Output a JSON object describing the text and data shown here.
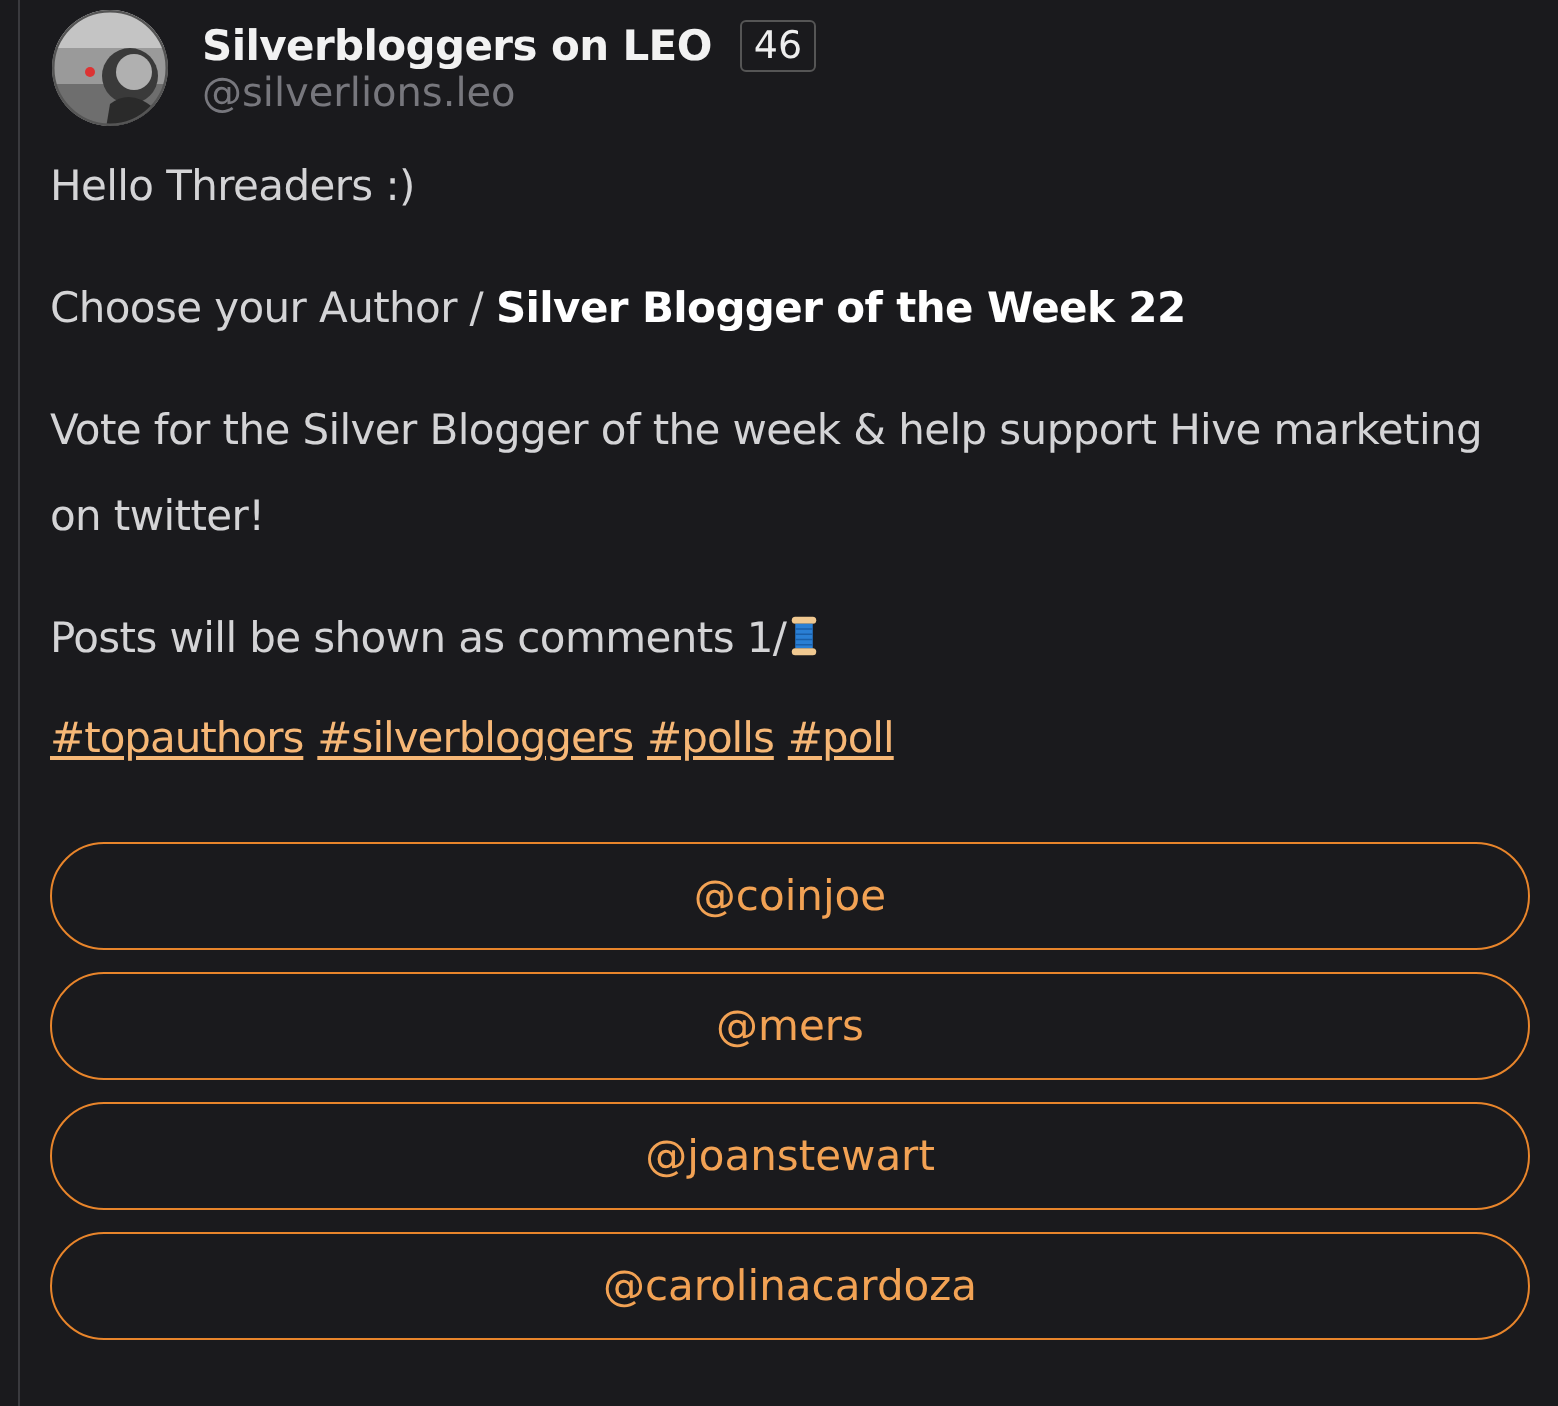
{
  "author": {
    "name": "Silverbloggers on LEO",
    "badge": "46",
    "handle": "@silverlions.leo"
  },
  "paragraphs": [
    "Hello Threaders :)",
    "Choose your Author / **Silver Blogger of the Week 22**",
    "Vote for the Silver Blogger of the week & help support Hive marketing on twitter!",
    "Posts will be shown as comments 1/"
  ],
  "tags": [
    "#topauthors",
    "#silverbloggers",
    "#polls",
    "#poll"
  ],
  "poll_options": [
    "@coinjoe",
    "@mers",
    "@joanstewart",
    "@carolinacardoza"
  ]
}
